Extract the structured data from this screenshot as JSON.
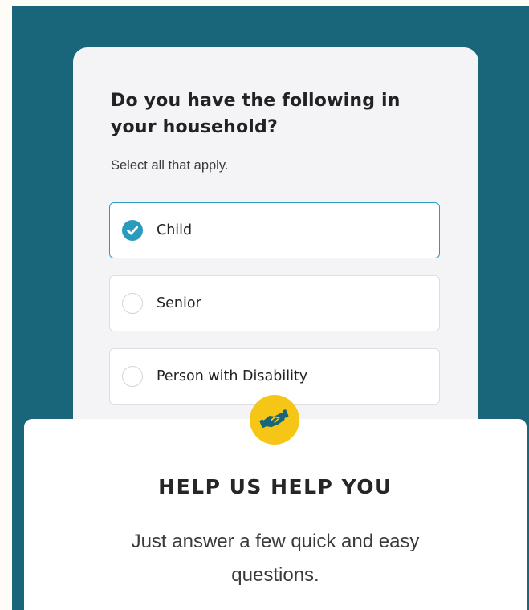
{
  "question": {
    "title": "Do you have the following in your household?",
    "subtitle": "Select all that apply.",
    "options": [
      {
        "label": "Child",
        "selected": true
      },
      {
        "label": "Senior",
        "selected": false
      },
      {
        "label": "Person with Disability",
        "selected": false
      }
    ]
  },
  "help": {
    "icon": "handshake-icon",
    "title": "HELP US HELP YOU",
    "text": "Just answer a few quick and easy questions."
  },
  "colors": {
    "page_background": "#196579",
    "accent": "#2a9bbd",
    "badge": "#f6c617",
    "card": "#f4f4f6"
  }
}
